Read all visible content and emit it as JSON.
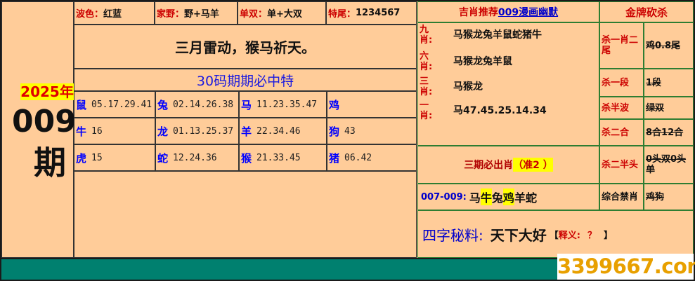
{
  "left": {
    "year": "2025年",
    "issue": "009",
    "qi": "期"
  },
  "top_info": {
    "boseLabel": "波色：",
    "boseVal": "红蓝",
    "jiayeLabel": "家野：",
    "jiayeVal": "野+马羊",
    "danshuangLabel": "单双：",
    "danshuangVal": "单+大双",
    "teweiLabel": "特尾：",
    "teweiVal": "1234567"
  },
  "slogan": "三月雷动，猴马祈天。",
  "codes_title": "30码期期必中特",
  "zodiac_rows": [
    [
      {
        "z": "鼠",
        "n": "05.17.29.41"
      },
      {
        "z": "兔",
        "n": "02.14.26.38"
      },
      {
        "z": "马",
        "n": "11.23.35.47"
      },
      {
        "z": "鸡",
        "n": ""
      }
    ],
    [
      {
        "z": "牛",
        "n": "16"
      },
      {
        "z": "龙",
        "n": "01.13.25.37"
      },
      {
        "z": "羊",
        "n": "22.34.46"
      },
      {
        "z": "狗",
        "n": "43"
      }
    ],
    [
      {
        "z": "虎",
        "n": "15"
      },
      {
        "z": "蛇",
        "n": "12.24.36"
      },
      {
        "z": "猴",
        "n": "21.33.45"
      },
      {
        "z": "猪",
        "n": "06.42"
      }
    ]
  ],
  "rec": {
    "prefix": "吉肖推荐",
    "link": "009漫画幽默",
    "rows": [
      {
        "label": "九肖:",
        "val": "马猴龙兔羊鼠蛇猪牛"
      },
      {
        "label": "六肖:",
        "val": "马猴龙兔羊鼠"
      },
      {
        "label": "三肖:",
        "val": "马猴龙"
      },
      {
        "label": "一肖:",
        "val": "马47.45.25.14.34"
      }
    ]
  },
  "kill": {
    "title": "金牌砍杀",
    "rows": [
      {
        "label": "杀一肖二尾",
        "val": "鸡0.8尾"
      },
      {
        "label": "杀一段",
        "val": "1段"
      },
      {
        "label": "杀半波",
        "val": "绿双"
      },
      {
        "label": "杀二合",
        "val": "8合12合"
      },
      {
        "label": "杀二半头",
        "val": "0头双0头单"
      },
      {
        "label": "综合禁肖",
        "val": "鸡狗"
      }
    ]
  },
  "sanqi": {
    "text": "三期必出肖",
    "note": "（准2 ）"
  },
  "range": {
    "label": "007-009:",
    "z1": "马",
    "z2": "牛",
    "z3": "兔",
    "z4": "鸡",
    "z5": "羊蛇"
  },
  "sizi": {
    "label": "四字秘料:",
    "val": "天下大好",
    "bl": "【",
    "note_label": "释义:",
    "note_val": "？",
    "br": "】"
  },
  "watermark": "3399667.com"
}
